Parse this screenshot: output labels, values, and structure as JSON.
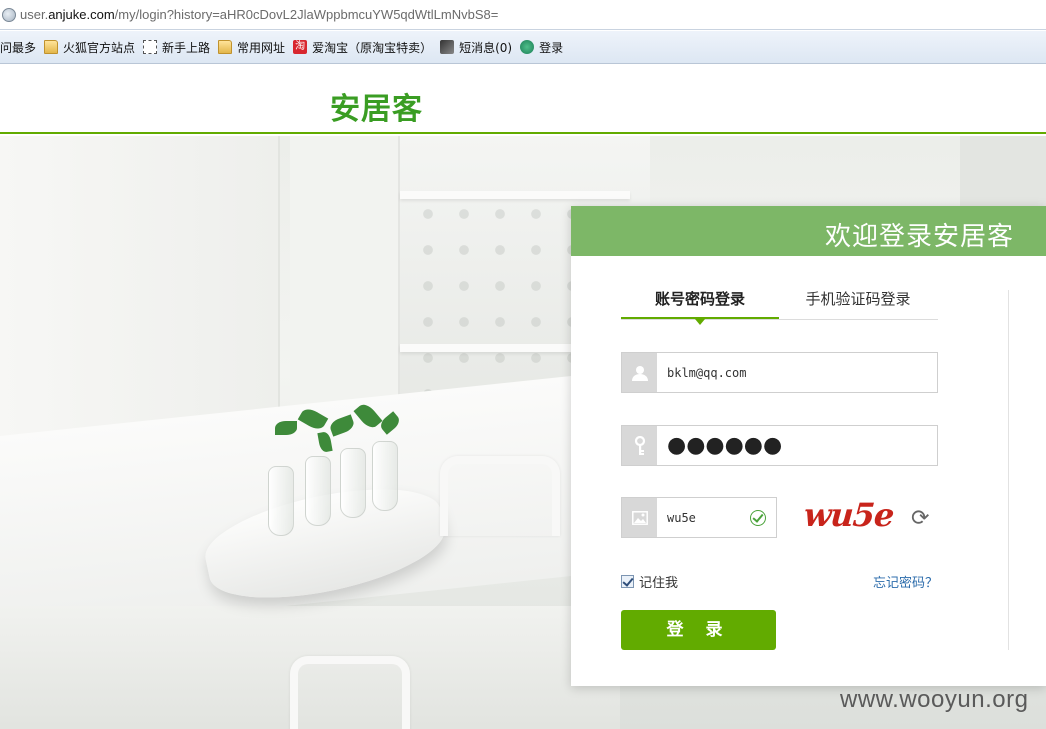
{
  "browser": {
    "url_prefix": "user.",
    "url_domain": "anjuke.com",
    "url_suffix": "/my/login?history=aHR0cDovL2JlaWppbmcuYW5qdWtlLmNvbS8=",
    "bookmarks": [
      {
        "label": "问最多",
        "icon": "none"
      },
      {
        "label": "火狐官方站点",
        "icon": "folder-icon"
      },
      {
        "label": "新手上路",
        "icon": "dashed-page-icon"
      },
      {
        "label": "常用网址",
        "icon": "folder-icon"
      },
      {
        "label": "爱淘宝（原淘宝特卖）",
        "icon": "taobao-icon"
      },
      {
        "label": "短消息(0)",
        "icon": "message-icon"
      },
      {
        "label": "登录",
        "icon": "login-icon"
      }
    ]
  },
  "header": {
    "logo": "安居客"
  },
  "login": {
    "title": "欢迎登录安居客",
    "tabs": [
      {
        "label": "账号密码登录",
        "active": true
      },
      {
        "label": "手机验证码登录",
        "active": false
      }
    ],
    "username_value": "bklm@qq.com",
    "password_mask": "●●●●●●",
    "captcha_input": "wu5e",
    "captcha_image_text": "wu5e",
    "remember_label": "记住我",
    "remember_checked": true,
    "forgot_label": "忘记密码？",
    "submit_label": "登 录",
    "accent_color": "#62ab00"
  },
  "watermark": "www.wooyun.org"
}
